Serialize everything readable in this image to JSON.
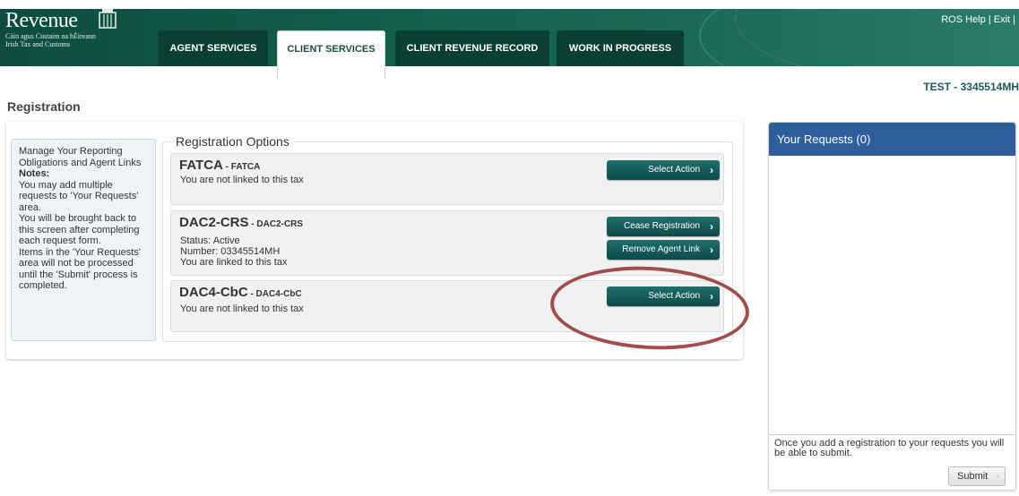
{
  "header": {
    "logo_word": "Revenue",
    "logo_sub1": "Cáin agus Custaim na hÉireann",
    "logo_sub2": "Irish Tax and Customs",
    "help_link": "ROS Help",
    "separator": "|",
    "exit_link": "Exit |",
    "tabs": [
      {
        "label": "AGENT SERVICES",
        "active": false
      },
      {
        "label": "CLIENT SERVICES",
        "active": true
      },
      {
        "label": "CLIENT REVENUE RECORD",
        "active": false
      },
      {
        "label": "WORK IN PROGRESS",
        "active": false
      }
    ],
    "colors": {
      "header_bg": "#13604d",
      "tab_bg": "#0b3f34",
      "accent": "#1c5c57"
    }
  },
  "test_id": "TEST - 3345514MH",
  "page_title": "Registration",
  "notes": {
    "intro": "Manage Your Reporting Obligations and Agent Links",
    "heading": "Notes:",
    "lines": [
      "You may add multiple requests to 'Your Requests' area.",
      "You will be brought back to this screen after completing each request form.",
      "Items in the 'Your Requests' area will not be processed until the 'Submit' process is completed."
    ]
  },
  "registration_options": {
    "legend": "Registration Options",
    "taxes": [
      {
        "name": "FATCA",
        "code": " - FATCA",
        "lines": [
          "You are not linked to this tax"
        ],
        "buttons": [
          "Select Action"
        ]
      },
      {
        "name": "DAC2-CRS",
        "code": " - DAC2-CRS",
        "lines": [
          "Status: Active",
          "Number: 03345514MH",
          "You are linked to this tax"
        ],
        "buttons": [
          "Cease Registration",
          "Remove Agent Link"
        ]
      },
      {
        "name": "DAC4-CbC",
        "code": " - DAC4-CbC",
        "lines": [
          "You are not linked to this tax"
        ],
        "buttons": [
          "Select Action"
        ]
      }
    ],
    "highlight_color": "#a04d4d"
  },
  "requests": {
    "title": "Your Requests (0)",
    "footer_text": "Once you add a registration to your requests you will be able to submit.",
    "submit_label": "Submit",
    "header_color": "#2f5e9e"
  },
  "icons": {
    "chevron": "›"
  }
}
